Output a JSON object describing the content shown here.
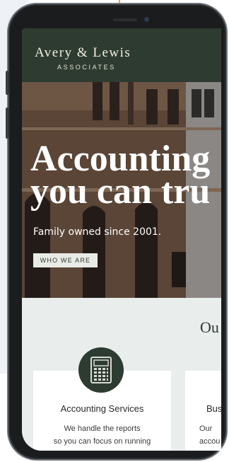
{
  "header": {
    "logo_main": "Avery & Lewis",
    "logo_sub": "ASSOCIATES"
  },
  "hero": {
    "title_line1": "Accounting",
    "title_line2": "you can tru",
    "subtitle": "Family owned since 2001.",
    "cta_label": "WHO WE ARE"
  },
  "services": {
    "heading": "Ou",
    "cards": [
      {
        "icon": "calculator-icon",
        "title": "Accounting Services",
        "text_line1": "We handle the reports",
        "text_line2": "so you can focus on running"
      },
      {
        "title": "Bus",
        "text_line1": "Our",
        "text_line2": "accou"
      }
    ]
  },
  "colors": {
    "brand_green": "#2e3b30",
    "page_bg": "#e9eeec",
    "accent_arrow": "#f0a23a"
  }
}
